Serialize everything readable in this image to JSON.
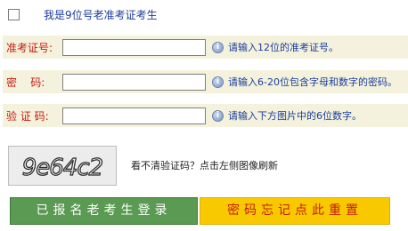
{
  "old_candidate": {
    "label": "我是9位号老准考证考生",
    "checked": false
  },
  "fields": [
    {
      "label": "准考证号:",
      "value": "",
      "hint": "请输入12位的准考证号。"
    },
    {
      "label": "密    码:",
      "value": "",
      "hint": "请输入6-20位包含字母和数字的密码。"
    },
    {
      "label": "验 证 码:",
      "value": "",
      "hint": "请输入下方图片中的6位数字。"
    }
  ],
  "captcha": {
    "text": "9e64c2",
    "hint": "看不清验证码？点击左侧图像刷新"
  },
  "buttons": {
    "login": "已报名老考生登录",
    "forgot": "密码忘记点此重置"
  },
  "colors": {
    "label_red": "#c51a12",
    "hint_blue": "#1a3d9e",
    "row_bg": "#f4f2dc",
    "login_green": "#5a9a52",
    "forgot_yellow": "#f9c900"
  }
}
